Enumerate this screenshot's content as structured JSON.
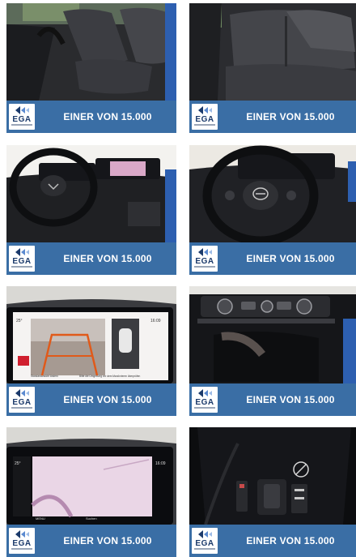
{
  "tiles": [
    {
      "alt": "Fahrersitz",
      "logo": "EGA",
      "banner": "EINER VON 15.000"
    },
    {
      "alt": "Rücksitze",
      "logo": "EGA",
      "banner": "EINER VON 15.000"
    },
    {
      "alt": "Cockpit",
      "logo": "EGA",
      "banner": "EINER VON 15.000"
    },
    {
      "alt": "Lenkrad",
      "logo": "EGA",
      "banner": "EINER VON 15.000"
    },
    {
      "alt": "Rückfahrkamera",
      "logo": "EGA",
      "banner": "EINER VON 15.000"
    },
    {
      "alt": "Mittelkonsole",
      "logo": "EGA",
      "banner": "EINER VON 15.000"
    },
    {
      "alt": "Navigation",
      "logo": "EGA",
      "banner": "EINER VON 15.000"
    },
    {
      "alt": "Schaltkonsole",
      "logo": "EGA",
      "banner": "EINER VON 15.000"
    }
  ],
  "screen_texts": {
    "camera_time": "16:09",
    "camera_temp": "25° ",
    "camera_hint": "Bitte die Umgebung vor dem Manövrieren überprüfen",
    "camera_button": "Standardansicht ändern",
    "nav_temp": "25°",
    "nav_time": "16:09",
    "nav_menu": "MENU",
    "nav_search": "Suchen"
  },
  "colors": {
    "banner": "#3a6ea5",
    "logo_blue": "#1b3a6b",
    "logo_light": "#5b8ad0"
  }
}
